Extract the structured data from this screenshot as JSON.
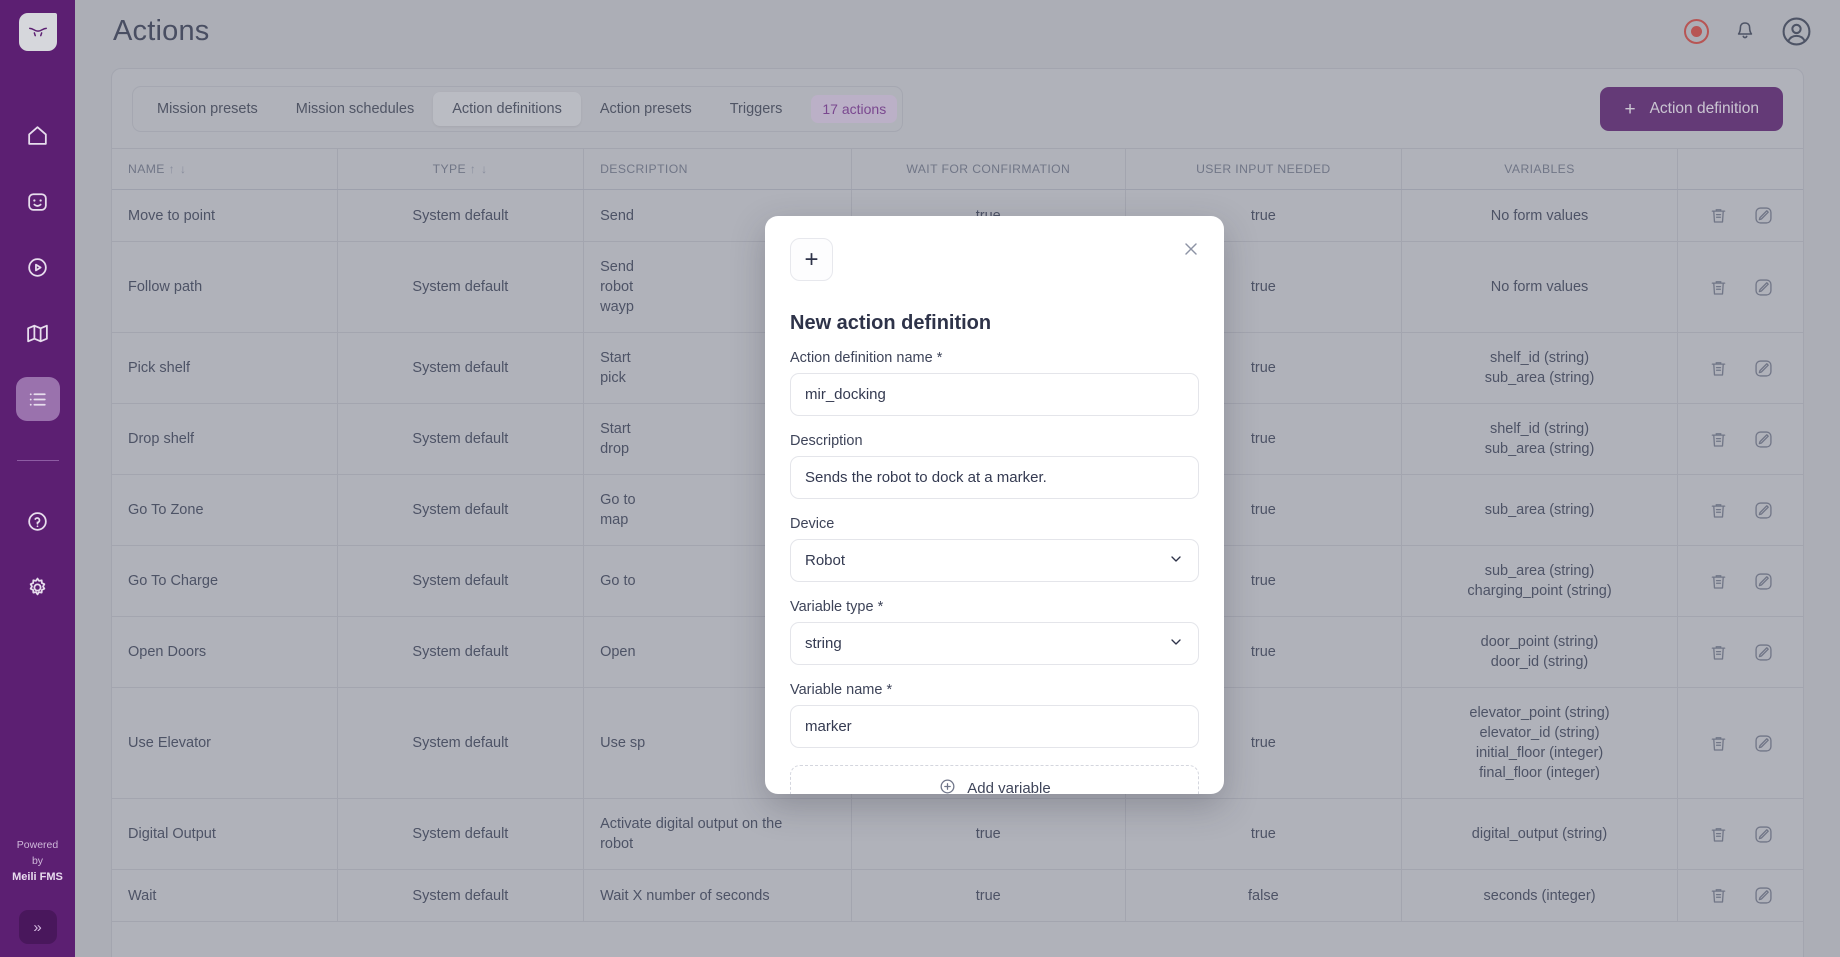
{
  "sidebar": {
    "logo_icon": "meili-logo-icon",
    "items": [
      {
        "icon": "home-icon",
        "name": "sidebar-item-home",
        "active": false
      },
      {
        "icon": "robot-face-icon",
        "name": "sidebar-item-robots",
        "active": false
      },
      {
        "icon": "play-circle-icon",
        "name": "sidebar-item-missions",
        "active": false
      },
      {
        "icon": "map-icon",
        "name": "sidebar-item-maps",
        "active": false
      },
      {
        "icon": "list-icon",
        "name": "sidebar-item-actions",
        "active": true
      }
    ],
    "bottom_items": [
      {
        "icon": "help-circle-icon",
        "name": "sidebar-item-help",
        "active": false
      },
      {
        "icon": "gear-icon",
        "name": "sidebar-item-settings",
        "active": false
      }
    ],
    "powered_line1": "Powered",
    "powered_line2": "by",
    "powered_brand": "Meili FMS",
    "collapse_label": "»"
  },
  "header": {
    "title": "Actions",
    "record_icon": "record-icon",
    "bell_icon": "bell-icon",
    "account_icon": "user-account-icon"
  },
  "tabs": [
    {
      "label": "Mission presets",
      "active": false
    },
    {
      "label": "Mission schedules",
      "active": false
    },
    {
      "label": "Action definitions",
      "active": true
    },
    {
      "label": "Action presets",
      "active": false
    },
    {
      "label": "Triggers",
      "active": false
    }
  ],
  "count_badge": "17 actions",
  "new_button": {
    "plus": "+",
    "label": "Action definition"
  },
  "table": {
    "columns": [
      {
        "label": "NAME",
        "sortable": true,
        "align": "left"
      },
      {
        "label": "TYPE",
        "sortable": true,
        "align": "center"
      },
      {
        "label": "DESCRIPTION",
        "sortable": false,
        "align": "left"
      },
      {
        "label": "WAIT FOR CONFIRMATION",
        "sortable": false,
        "align": "center"
      },
      {
        "label": "USER INPUT NEEDED",
        "sortable": false,
        "align": "center"
      },
      {
        "label": "VARIABLES",
        "sortable": false,
        "align": "center"
      },
      {
        "label": "",
        "sortable": false,
        "align": "center"
      }
    ],
    "sort_arrows": "↑ ↓",
    "rows": [
      {
        "name": "Move to point",
        "type": "System default",
        "description": "Send",
        "wait": "true",
        "user_input": "true",
        "variables": "No form values"
      },
      {
        "name": "Follow path",
        "type": "System default",
        "description": "Send\nrobot\nwayp",
        "wait": "",
        "user_input": "true",
        "variables": "No form values"
      },
      {
        "name": "Pick shelf",
        "type": "System default",
        "description": "Start\npick",
        "wait": "",
        "user_input": "true",
        "variables": "shelf_id (string)\nsub_area (string)"
      },
      {
        "name": "Drop shelf",
        "type": "System default",
        "description": "Start\ndrop",
        "wait": "",
        "user_input": "true",
        "variables": "shelf_id (string)\nsub_area (string)"
      },
      {
        "name": "Go To Zone",
        "type": "System default",
        "description": "Go to\nmap",
        "wait": "",
        "user_input": "true",
        "variables": "sub_area (string)"
      },
      {
        "name": "Go To Charge",
        "type": "System default",
        "description": "Go to",
        "wait": "",
        "user_input": "true",
        "variables": "sub_area (string)\ncharging_point (string)"
      },
      {
        "name": "Open Doors",
        "type": "System default",
        "description": "Open",
        "wait": "",
        "user_input": "true",
        "variables": "door_point (string)\ndoor_id (string)"
      },
      {
        "name": "Use Elevator",
        "type": "System default",
        "description": "Use sp",
        "wait": "",
        "user_input": "true",
        "variables": "elevator_point (string)\nelevator_id (string)\ninitial_floor (integer)\nfinal_floor (integer)"
      },
      {
        "name": "Digital Output",
        "type": "System default",
        "description": "Activate digital output on the\nrobot",
        "wait": "true",
        "user_input": "true",
        "variables": "digital_output (string)"
      },
      {
        "name": "Wait",
        "type": "System default",
        "description": "Wait X number of seconds",
        "wait": "true",
        "user_input": "false",
        "variables": "seconds (integer)"
      }
    ],
    "row_actions": {
      "delete_icon": "trash-icon",
      "edit_icon": "edit-pencil-icon"
    }
  },
  "modal": {
    "plus_icon": "plus-icon",
    "close_icon": "close-icon",
    "title": "New action definition",
    "fields": [
      {
        "label": "Action definition name *",
        "value": "mir_docking",
        "kind": "input"
      },
      {
        "label": "Description",
        "value": "Sends the robot to dock at a marker.",
        "kind": "input"
      },
      {
        "label": "Device",
        "value": "Robot",
        "kind": "select"
      },
      {
        "label": "Variable type *",
        "value": "string",
        "kind": "select"
      },
      {
        "label": "Variable name *",
        "value": "marker",
        "kind": "input"
      }
    ],
    "add_variable_label": "Add variable"
  },
  "colors": {
    "brand_purple": "#5c1f72",
    "badge_bg": "#d9c8e4",
    "badge_text": "#7b3294",
    "record_red": "#d3453f",
    "page_bg": "#c3c5cc",
    "text_dark": "#343a51"
  }
}
